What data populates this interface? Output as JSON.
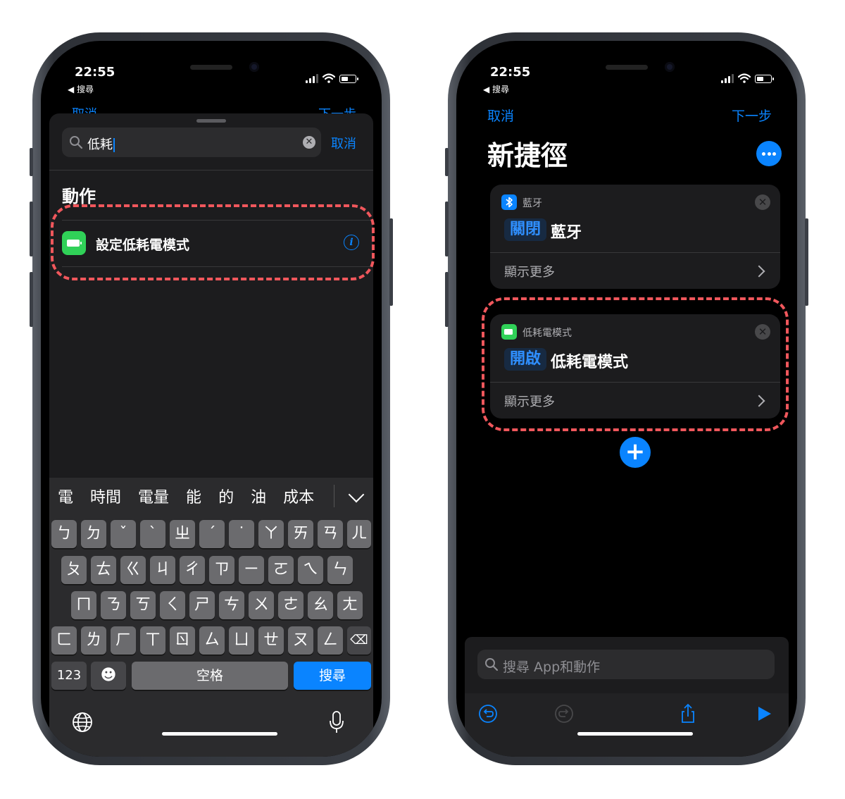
{
  "status": {
    "time": "22:55",
    "back_label": "◀ 搜尋"
  },
  "left": {
    "peek": {
      "cancel": "取消",
      "next": "下一步"
    },
    "search": {
      "query": "低耗",
      "cancel": "取消"
    },
    "section_title": "動作",
    "action": {
      "label": "設定低耗電模式",
      "info_glyph": "i"
    },
    "candidates": [
      "電",
      "時間",
      "電量",
      "能",
      "的",
      "油",
      "成本"
    ],
    "keyboard": {
      "row1": [
        "ㄅ",
        "ㄉ",
        "ˇ",
        "ˋ",
        "ㄓ",
        "ˊ",
        "˙",
        "ㄚ",
        "ㄞ",
        "ㄢ",
        "ㄦ"
      ],
      "row2": [
        "ㄆ",
        "ㄊ",
        "ㄍ",
        "ㄐ",
        "ㄔ",
        "ㄗ",
        "ㄧ",
        "ㄛ",
        "ㄟ",
        "ㄣ"
      ],
      "row3": [
        "ㄇ",
        "ㄋ",
        "ㄎ",
        "ㄑ",
        "ㄕ",
        "ㄘ",
        "ㄨ",
        "ㄜ",
        "ㄠ",
        "ㄤ"
      ],
      "row4": [
        "ㄈ",
        "ㄌ",
        "ㄏ",
        "ㄒ",
        "ㄖ",
        "ㄙ",
        "ㄩ",
        "ㄝ",
        "ㄡ",
        "ㄥ"
      ],
      "numbers_key": "123",
      "emoji_key": "☻",
      "space_key": "空格",
      "search_key": "搜尋",
      "delete_key": "⌫"
    }
  },
  "right": {
    "nav": {
      "cancel": "取消",
      "next": "下一步"
    },
    "title": "新捷徑",
    "cards": [
      {
        "app_name": "藍牙",
        "token": "關閉",
        "subject": "藍牙",
        "more": "顯示更多",
        "icon_color": "#0a84ff"
      },
      {
        "app_name": "低耗電模式",
        "token": "開啟",
        "subject": "低耗電模式",
        "more": "顯示更多",
        "icon_color": "#30d158"
      }
    ],
    "bottom_search_placeholder": "搜尋 App和動作"
  },
  "colors": {
    "accent": "#0a84ff",
    "highlight": "#f0575c",
    "battery_green": "#30d158"
  }
}
